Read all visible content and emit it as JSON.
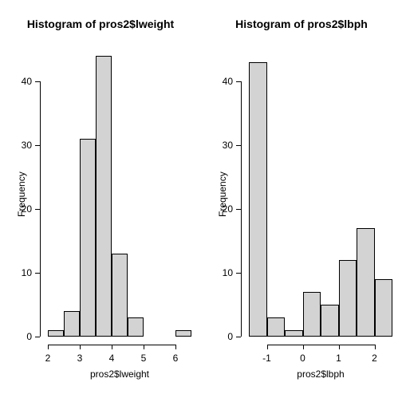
{
  "chart_data": [
    {
      "type": "histogram",
      "title": "Histogram of pros2$lweight",
      "xlabel": "pros2$lweight",
      "ylabel": "Frequency",
      "bin_width": 0.5,
      "bins": [
        {
          "start": 2.0,
          "end": 2.5,
          "count": 1
        },
        {
          "start": 2.5,
          "end": 3.0,
          "count": 4
        },
        {
          "start": 3.0,
          "end": 3.5,
          "count": 31
        },
        {
          "start": 3.5,
          "end": 4.0,
          "count": 44
        },
        {
          "start": 4.0,
          "end": 4.5,
          "count": 13
        },
        {
          "start": 4.5,
          "end": 5.0,
          "count": 3
        },
        {
          "start": 5.0,
          "end": 5.5,
          "count": 0
        },
        {
          "start": 5.5,
          "end": 6.0,
          "count": 0
        },
        {
          "start": 6.0,
          "end": 6.5,
          "count": 1
        }
      ],
      "x_ticks": [
        2,
        3,
        4,
        5,
        6
      ],
      "y_ticks": [
        0,
        10,
        20,
        30,
        40
      ],
      "xlim": [
        2.0,
        6.5
      ],
      "ylim": [
        0,
        45
      ]
    },
    {
      "type": "histogram",
      "title": "Histogram of pros2$lbph",
      "xlabel": "pros2$lbph",
      "ylabel": "Frequency",
      "bin_width": 0.5,
      "bins": [
        {
          "start": -1.5,
          "end": -1.0,
          "count": 43
        },
        {
          "start": -1.0,
          "end": -0.5,
          "count": 3
        },
        {
          "start": -0.5,
          "end": 0.0,
          "count": 1
        },
        {
          "start": 0.0,
          "end": 0.5,
          "count": 7
        },
        {
          "start": 0.5,
          "end": 1.0,
          "count": 5
        },
        {
          "start": 1.0,
          "end": 1.5,
          "count": 12
        },
        {
          "start": 1.5,
          "end": 2.0,
          "count": 17
        },
        {
          "start": 2.0,
          "end": 2.5,
          "count": 9
        }
      ],
      "x_ticks": [
        -1,
        0,
        1,
        2
      ],
      "y_ticks": [
        0,
        10,
        20,
        30,
        40
      ],
      "xlim": [
        -1.5,
        2.5
      ],
      "ylim": [
        0,
        45
      ]
    }
  ]
}
